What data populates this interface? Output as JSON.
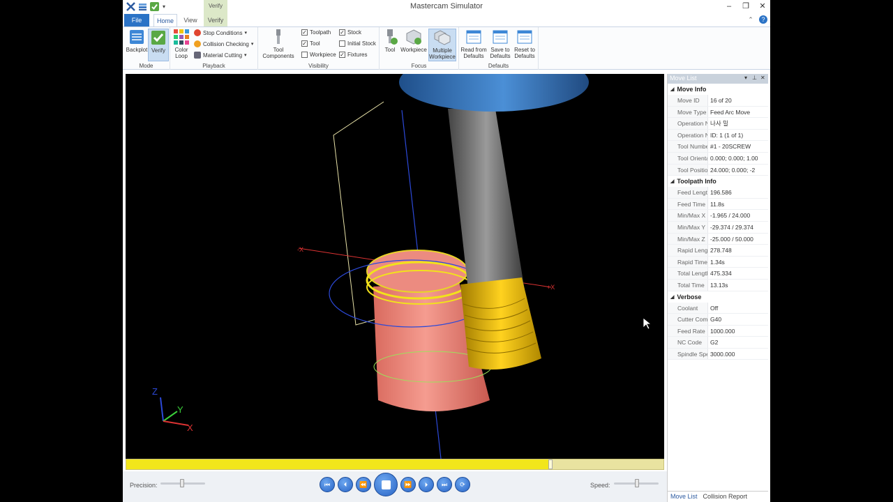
{
  "window": {
    "title": "Mastercam Simulator"
  },
  "qat": {
    "dropdown": "▾"
  },
  "tabs": {
    "file": "File",
    "home": "Home",
    "view": "View",
    "verify": "Verify",
    "context_group": "Verify"
  },
  "ribbon": {
    "mode": {
      "label": "Mode",
      "backplot": "Backplot",
      "verify": "Verify"
    },
    "playback": {
      "label": "Playback",
      "color_loop_1": "Color",
      "color_loop_2": "Loop",
      "stop_conditions": "Stop Conditions",
      "collision_checking": "Collision Checking",
      "material_cutting": "Material Cutting"
    },
    "tool_components": {
      "line1": "Tool",
      "line2": "Components"
    },
    "visibility": {
      "label": "Visibility",
      "toolpath": "Toolpath",
      "tool": "Tool",
      "workpiece": "Workpiece",
      "stock": "Stock",
      "initial_stock": "Initial Stock",
      "fixtures": "Fixtures",
      "checked": [
        "toolpath",
        "tool",
        "stock",
        "fixtures"
      ]
    },
    "focus": {
      "label": "Focus",
      "tool": "Tool",
      "workpiece": "Workpiece",
      "multi_1": "Multiple",
      "multi_2": "Workpiece"
    },
    "defaults": {
      "label": "Defaults",
      "read_1": "Read from",
      "read_2": "Defaults",
      "save_1": "Save to",
      "save_2": "Defaults",
      "reset_1": "Reset to",
      "reset_2": "Defaults"
    }
  },
  "viewport": {
    "axis_z": "Z",
    "axis_y": "Y",
    "axis_x": "X",
    "neg_x": "-X",
    "pos_x": "+X",
    "colors": {
      "stock": "#e87b6e",
      "thread": "#e8b800",
      "holder": "#3a7cc4",
      "shank": "#6a6a6a",
      "toolpath_blue": "#2c49d8",
      "box_line": "#e8e2a8"
    }
  },
  "playback": {
    "precision_label": "Precision:",
    "speed_label": "Speed:",
    "progress": 0.79
  },
  "move_list": {
    "title": "Move List",
    "sections": [
      {
        "name": "Move Info",
        "rows": [
          {
            "k": "Move ID",
            "v": "16 of 20"
          },
          {
            "k": "Move Type",
            "v": "Feed Arc Move"
          },
          {
            "k": "Operation Na",
            "v": "나사 밀"
          },
          {
            "k": "Operation Nu",
            "v": "ID: 1 (1 of 1)"
          },
          {
            "k": "Tool Number",
            "v": "#1 - 20SCREW"
          },
          {
            "k": "Tool Orientati",
            "v": "0.000; 0.000; 1.00"
          },
          {
            "k": "Tool Position",
            "v": "24.000; 0.000; -2"
          }
        ]
      },
      {
        "name": "Toolpath Info",
        "rows": [
          {
            "k": "Feed Length",
            "v": "196.586"
          },
          {
            "k": "Feed Time",
            "v": "11.8s"
          },
          {
            "k": "Min/Max X",
            "v": "-1.965 / 24.000"
          },
          {
            "k": "Min/Max Y",
            "v": "-29.374 / 29.374"
          },
          {
            "k": "Min/Max Z",
            "v": "-25.000 / 50.000"
          },
          {
            "k": "Rapid Length",
            "v": "278.748"
          },
          {
            "k": "Rapid Time",
            "v": "1.34s"
          },
          {
            "k": "Total Length",
            "v": "475.334"
          },
          {
            "k": "Total Time",
            "v": "13.13s"
          }
        ]
      },
      {
        "name": "Verbose",
        "rows": [
          {
            "k": "Coolant",
            "v": "Off"
          },
          {
            "k": "Cutter Comp",
            "v": "G40"
          },
          {
            "k": "Feed Rate",
            "v": "1000.000"
          },
          {
            "k": "NC Code",
            "v": "G2"
          },
          {
            "k": "Spindle Speed",
            "v": "3000.000"
          }
        ]
      }
    ],
    "bottom_tabs": [
      "Move List",
      "Collision Report"
    ]
  }
}
